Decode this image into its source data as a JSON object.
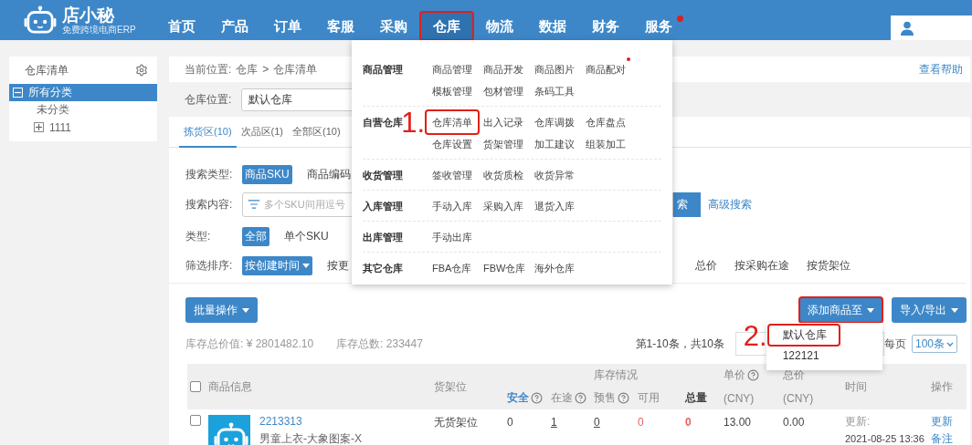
{
  "header": {
    "logo": {
      "name": "店小秘",
      "tagline": "免费跨境电商ERP"
    },
    "nav": [
      {
        "label": "首页",
        "selected": false,
        "annotated": false,
        "badge": false
      },
      {
        "label": "产品",
        "selected": false,
        "annotated": false,
        "badge": false
      },
      {
        "label": "订单",
        "selected": false,
        "annotated": false,
        "badge": false
      },
      {
        "label": "客服",
        "selected": false,
        "annotated": false,
        "badge": false
      },
      {
        "label": "采购",
        "selected": false,
        "annotated": false,
        "badge": false
      },
      {
        "label": "仓库",
        "selected": true,
        "annotated": true,
        "badge": false
      },
      {
        "label": "物流",
        "selected": false,
        "annotated": false,
        "badge": false
      },
      {
        "label": "数据",
        "selected": false,
        "annotated": false,
        "badge": false
      },
      {
        "label": "财务",
        "selected": false,
        "annotated": false,
        "badge": false
      },
      {
        "label": "服务",
        "selected": false,
        "annotated": false,
        "badge": true
      }
    ],
    "nav_menu": {
      "sections": [
        {
          "label": "商品管理",
          "items": [
            {
              "label": "商品管理",
              "annotated": false,
              "badge": false
            },
            {
              "label": "商品开发",
              "annotated": false,
              "badge": false
            },
            {
              "label": "商品图片",
              "annotated": false,
              "badge": false
            },
            {
              "label": "商品配对",
              "annotated": false,
              "badge": true
            },
            {
              "label": "模板管理",
              "annotated": false,
              "badge": false
            },
            {
              "label": "包材管理",
              "annotated": false,
              "badge": false
            },
            {
              "label": "条码工具",
              "annotated": false,
              "badge": false
            }
          ]
        },
        {
          "label": "自营仓库",
          "items": [
            {
              "label": "仓库清单",
              "annotated": true,
              "badge": false,
              "callout": "1."
            },
            {
              "label": "出入记录",
              "annotated": false,
              "badge": false
            },
            {
              "label": "仓库调拨",
              "annotated": false,
              "badge": false
            },
            {
              "label": "仓库盘点",
              "annotated": false,
              "badge": false
            },
            {
              "label": "仓库设置",
              "annotated": false,
              "badge": false
            },
            {
              "label": "货架管理",
              "annotated": false,
              "badge": false
            },
            {
              "label": "加工建议",
              "annotated": false,
              "badge": false
            },
            {
              "label": "组装加工",
              "annotated": false,
              "badge": false
            }
          ]
        },
        {
          "label": "收货管理",
          "items": [
            {
              "label": "签收管理",
              "annotated": false,
              "badge": false
            },
            {
              "label": "收货质检",
              "annotated": false,
              "badge": false
            },
            {
              "label": "收货异常",
              "annotated": false,
              "badge": false
            }
          ]
        },
        {
          "label": "入库管理",
          "items": [
            {
              "label": "手动入库",
              "annotated": false,
              "badge": false
            },
            {
              "label": "采购入库",
              "annotated": false,
              "badge": false
            },
            {
              "label": "退货入库",
              "annotated": false,
              "badge": false
            }
          ]
        },
        {
          "label": "出库管理",
          "items": [
            {
              "label": "手动出库",
              "annotated": false,
              "badge": false
            }
          ]
        },
        {
          "label": "其它仓库",
          "items": [
            {
              "label": "FBA仓库",
              "annotated": false,
              "badge": false
            },
            {
              "label": "FBW仓库",
              "annotated": false,
              "badge": false
            },
            {
              "label": "海外仓库",
              "annotated": false,
              "badge": false
            }
          ]
        }
      ]
    }
  },
  "sidebar": {
    "title": "仓库清单",
    "items": [
      {
        "label": "所有分类",
        "kind": "group",
        "expanded": true,
        "selected": true,
        "children": [
          {
            "label": "未分类",
            "kind": "leaf",
            "selected": false
          },
          {
            "label": "1111",
            "kind": "group",
            "expanded": false,
            "selected": false
          }
        ]
      }
    ]
  },
  "breadcrumb": {
    "label": "当前位置:",
    "path": [
      "仓库",
      "仓库清单"
    ],
    "separator": ">",
    "help": "查看帮助"
  },
  "location": {
    "label": "仓库位置:",
    "value": "默认仓库"
  },
  "tabs": [
    {
      "label": "拣货区(10)",
      "selected": true
    },
    {
      "label": "次品区(1)",
      "selected": false
    },
    {
      "label": "全部区(10)",
      "selected": false
    }
  ],
  "filters": [
    {
      "label": "搜索类型:",
      "kind": "options",
      "options": [
        {
          "label": "商品SKU",
          "selected": true,
          "caret": false
        },
        {
          "label": "商品编码",
          "selected": false,
          "caret": false
        }
      ]
    },
    {
      "label": "搜索内容:",
      "kind": "search",
      "placeholder": "多个SKU间用逗号",
      "button": "索",
      "link": "高级搜索"
    },
    {
      "label": "类型:",
      "kind": "options",
      "options": [
        {
          "label": "全部",
          "selected": true,
          "caret": false
        },
        {
          "label": "单个SKU",
          "selected": false,
          "caret": false
        }
      ]
    },
    {
      "label": "筛选排序:",
      "kind": "options",
      "options": [
        {
          "label": "按创建时间",
          "selected": true,
          "caret": true
        },
        {
          "label": "按更",
          "selected": false,
          "caret": false
        }
      ],
      "more_options": [
        {
          "label": "总价",
          "selected": false,
          "caret": false
        },
        {
          "label": "按采购在途",
          "selected": false,
          "caret": false
        },
        {
          "label": "按货架位",
          "selected": false,
          "caret": false
        }
      ]
    }
  ],
  "toolbar": {
    "bulk": "批量操作",
    "add": {
      "label": "添加商品至",
      "annotated": true
    },
    "io": "导入/导出"
  },
  "add_menu": [
    {
      "label": "默认仓库",
      "annotated": true,
      "callout": "2."
    },
    {
      "label": "122121",
      "annotated": false
    }
  ],
  "stats": [
    {
      "label": "库存总价值:",
      "value": "¥ 2801482.10"
    },
    {
      "label": "库存总数:",
      "value": "233447"
    }
  ],
  "pagination": {
    "summary": "第1-10条，共10条",
    "per_page_label": "每页",
    "per_page": "100条"
  },
  "table": {
    "select_all": {
      "checked": false
    },
    "columns": {
      "info": "商品信息",
      "shelf": "货架位",
      "stock_group": "库存情况",
      "stock": [
        {
          "label": "安全",
          "help": true,
          "kind": "active"
        },
        {
          "label": "在途",
          "help": true,
          "kind": "plain"
        },
        {
          "label": "预售",
          "help": true,
          "kind": "plain"
        },
        {
          "label": "可用",
          "help": false,
          "kind": "plain"
        },
        {
          "label": "总量",
          "help": false,
          "kind": "total"
        }
      ],
      "price": {
        "label": "单价",
        "unit": "(CNY)",
        "help": true
      },
      "total": {
        "label": "总价",
        "unit": "(CNY)",
        "help": false
      },
      "time": "时间",
      "actions": "操作"
    },
    "rows": [
      {
        "checked": false,
        "sku": "2213313",
        "name": "男童上衣-大象图案-X",
        "shelf": "无货架位",
        "stock": [
          {
            "value": "0",
            "kind": "plain"
          },
          {
            "value": "1",
            "kind": "link"
          },
          {
            "value": "0",
            "kind": "link"
          },
          {
            "value": "0",
            "kind": "alert"
          },
          {
            "value": "0",
            "kind": "alert-bold"
          }
        ],
        "price": "13.00",
        "total": "0.00",
        "time_label": "更新:",
        "time": "2021-08-25 13:36",
        "actions": [
          "更新",
          "备注"
        ]
      }
    ]
  }
}
